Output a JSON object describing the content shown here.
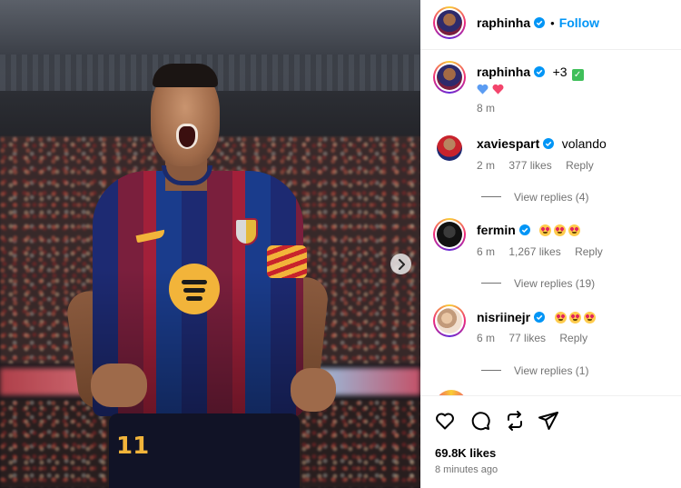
{
  "post": {
    "author": "raphinha",
    "follow_label": "Follow",
    "separator": "•"
  },
  "caption": {
    "username": "raphinha",
    "suffix": "+3",
    "time": "8 m"
  },
  "comments": [
    {
      "username": "xaviespart",
      "text": "volando",
      "time": "2 m",
      "likes": "377 likes",
      "reply_label": "Reply",
      "view_replies": "View replies (4)"
    },
    {
      "username": "fermin",
      "text": "",
      "time": "6 m",
      "likes": "1,267 likes",
      "reply_label": "Reply",
      "view_replies": "View replies (19)"
    },
    {
      "username": "nisriinejr",
      "text": "",
      "time": "6 m",
      "likes": "77 likes",
      "reply_label": "Reply",
      "view_replies": "View replies (1)"
    }
  ],
  "media": {
    "jersey_number": "11"
  },
  "footer": {
    "likes": "69.8K likes",
    "posted": "8 minutes ago"
  },
  "colors": {
    "link_blue": "#0095f6",
    "verified_blue": "#0095f6",
    "secondary_text": "#737373"
  },
  "icons": {
    "like": "heart-icon",
    "comment": "comment-icon",
    "repost": "repost-icon",
    "share": "share-icon",
    "next": "chevron-right-icon"
  }
}
